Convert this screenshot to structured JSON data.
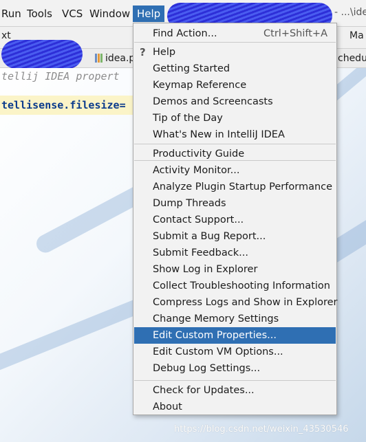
{
  "menubar": {
    "items": [
      {
        "label": "Run"
      },
      {
        "label": "Tools"
      },
      {
        "label": "VCS"
      },
      {
        "label": "Window"
      },
      {
        "label": "Help"
      }
    ],
    "title_path": "- ...\\ide"
  },
  "toolbar": {
    "left_text": "xt",
    "right_text": "Ma"
  },
  "tabs": [
    {
      "label": "idea.p"
    },
    {
      "label": "chedu"
    }
  ],
  "editor": {
    "comment_line": "tellij IDEA propert",
    "property_line": "tellisense.filesize="
  },
  "help_menu": {
    "groups": [
      [
        {
          "label": "Find Action...",
          "shortcut": "Ctrl+Shift+A"
        }
      ],
      [
        {
          "label": "Help",
          "icon": "help-question-icon"
        },
        {
          "label": "Getting Started"
        },
        {
          "label": "Keymap Reference"
        },
        {
          "label": "Demos and Screencasts"
        },
        {
          "label": "Tip of the Day"
        },
        {
          "label": "What's New in IntelliJ IDEA"
        }
      ],
      [
        {
          "label": "Productivity Guide"
        }
      ],
      [
        {
          "label": "Activity Monitor..."
        },
        {
          "label": "Analyze Plugin Startup Performance"
        },
        {
          "label": "Dump Threads"
        },
        {
          "label": "Contact Support..."
        },
        {
          "label": "Submit a Bug Report..."
        },
        {
          "label": "Submit Feedback..."
        },
        {
          "label": "Show Log in Explorer"
        },
        {
          "label": "Collect Troubleshooting Information"
        },
        {
          "label": "Compress Logs and Show in Explorer"
        },
        {
          "label": "Change Memory Settings"
        },
        {
          "label": "Edit Custom Properties...",
          "highlighted": true
        },
        {
          "label": "Edit Custom VM Options..."
        },
        {
          "label": "Debug Log Settings..."
        }
      ],
      [
        {
          "label": "Check for Updates..."
        },
        {
          "label": "About"
        }
      ]
    ]
  },
  "watermark": "https://blog.csdn.net/weixin_43530546",
  "colors": {
    "accent": "#2f6fb3",
    "menu_bg": "#f2f2f2",
    "redaction": "#2d2fd8"
  }
}
